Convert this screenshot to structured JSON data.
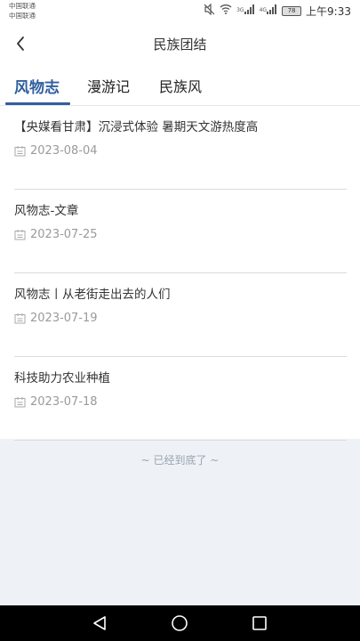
{
  "status_bar": {
    "carrier_1": "中国联通",
    "carrier_2": "中国联通",
    "network_1": "3G",
    "network_2": "4G",
    "battery": "78",
    "time": "上午9:33"
  },
  "header": {
    "title": "民族团结"
  },
  "tabs": [
    {
      "label": "风物志",
      "active": true
    },
    {
      "label": "漫游记",
      "active": false
    },
    {
      "label": "民族风",
      "active": false
    }
  ],
  "articles": [
    {
      "title": "【央媒看甘肃】沉浸式体验 暑期天文游热度高",
      "date": "2023-08-04"
    },
    {
      "title": "风物志-文章",
      "date": "2023-07-25"
    },
    {
      "title": "风物志丨从老街走出去的人们",
      "date": "2023-07-19"
    },
    {
      "title": "科技助力农业种植",
      "date": "2023-07-18"
    }
  ],
  "list_end_text": "~ 已经到底了 ~",
  "colors": {
    "accent": "#2f5f9e",
    "page_bg": "#eef2f7",
    "divider": "#dcdcdc",
    "muted_text": "#9a9a9a"
  }
}
